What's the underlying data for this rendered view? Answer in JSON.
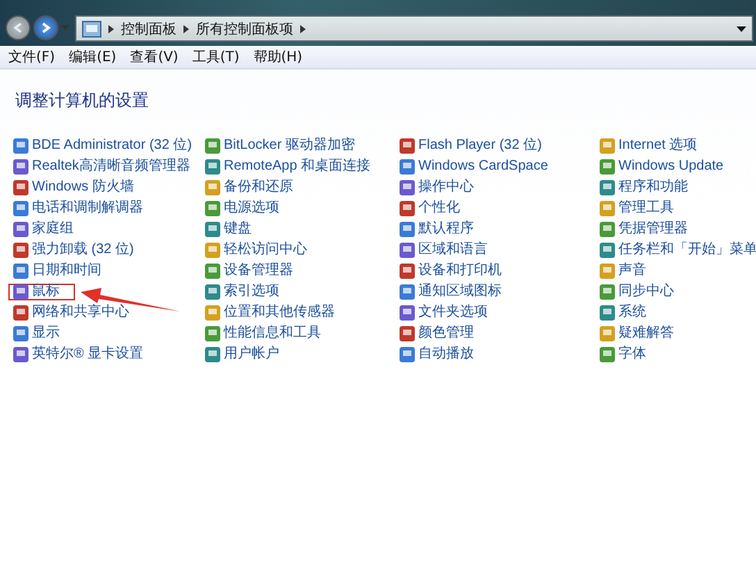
{
  "address_bar": {
    "breadcrumbs": [
      "控制面板",
      "所有控制面板项"
    ]
  },
  "menu": [
    "文件(F)",
    "编辑(E)",
    "查看(V)",
    "工具(T)",
    "帮助(H)"
  ],
  "heading": "调整计算机的设置",
  "items": [
    {
      "label": "BDE Administrator (32 位)",
      "highlighted": false
    },
    {
      "label": "BitLocker 驱动器加密",
      "highlighted": false
    },
    {
      "label": "Flash Player (32 位)",
      "highlighted": false
    },
    {
      "label": "Internet 选项",
      "highlighted": false
    },
    {
      "label": "Realtek高清晰音频管理器",
      "highlighted": false
    },
    {
      "label": "RemoteApp 和桌面连接",
      "highlighted": false
    },
    {
      "label": "Windows CardSpace",
      "highlighted": false
    },
    {
      "label": "Windows Update",
      "highlighted": false
    },
    {
      "label": "Windows 防火墙",
      "highlighted": false
    },
    {
      "label": "备份和还原",
      "highlighted": false
    },
    {
      "label": "操作中心",
      "highlighted": false
    },
    {
      "label": "程序和功能",
      "highlighted": false
    },
    {
      "label": "电话和调制解调器",
      "highlighted": false
    },
    {
      "label": "电源选项",
      "highlighted": false
    },
    {
      "label": "个性化",
      "highlighted": false
    },
    {
      "label": "管理工具",
      "highlighted": false
    },
    {
      "label": "家庭组",
      "highlighted": false
    },
    {
      "label": "键盘",
      "highlighted": false
    },
    {
      "label": "默认程序",
      "highlighted": false
    },
    {
      "label": "凭据管理器",
      "highlighted": false
    },
    {
      "label": "强力卸载 (32 位)",
      "highlighted": false
    },
    {
      "label": "轻松访问中心",
      "highlighted": false
    },
    {
      "label": "区域和语言",
      "highlighted": false
    },
    {
      "label": "任务栏和「开始」菜单",
      "highlighted": false
    },
    {
      "label": "日期和时间",
      "highlighted": false
    },
    {
      "label": "设备管理器",
      "highlighted": false
    },
    {
      "label": "设备和打印机",
      "highlighted": false
    },
    {
      "label": "声音",
      "highlighted": false
    },
    {
      "label": "鼠标",
      "highlighted": true
    },
    {
      "label": "索引选项",
      "highlighted": false
    },
    {
      "label": "通知区域图标",
      "highlighted": false
    },
    {
      "label": "同步中心",
      "highlighted": false
    },
    {
      "label": "网络和共享中心",
      "highlighted": false
    },
    {
      "label": "位置和其他传感器",
      "highlighted": false
    },
    {
      "label": "文件夹选项",
      "highlighted": false
    },
    {
      "label": "系统",
      "highlighted": false
    },
    {
      "label": "显示",
      "highlighted": false
    },
    {
      "label": "性能信息和工具",
      "highlighted": false
    },
    {
      "label": "颜色管理",
      "highlighted": false
    },
    {
      "label": "疑难解答",
      "highlighted": false
    },
    {
      "label": "英特尔® 显卡设置",
      "highlighted": false
    },
    {
      "label": "用户帐户",
      "highlighted": false
    },
    {
      "label": "自动播放",
      "highlighted": false
    },
    {
      "label": "字体",
      "highlighted": false
    }
  ]
}
